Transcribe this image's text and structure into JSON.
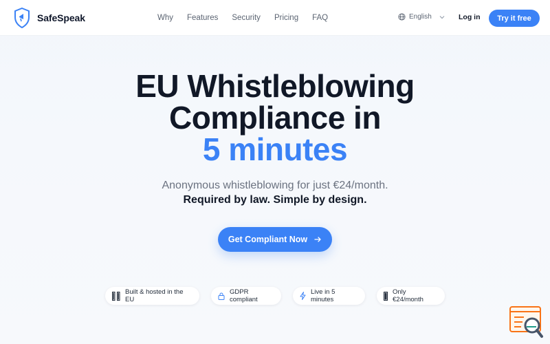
{
  "brand": {
    "name": "SafeSpeak",
    "logo_icon": "shield-icon"
  },
  "nav": {
    "items": [
      "Why",
      "Features",
      "Security",
      "Pricing",
      "FAQ"
    ]
  },
  "header": {
    "language": "English",
    "login_label": "Log in",
    "cta_label": "Try it free"
  },
  "hero": {
    "title_line1": "EU Whistleblowing",
    "title_line2": "Compliance in",
    "title_accent": "5 minutes",
    "subtitle": "Anonymous whistleblowing for just €24/month.",
    "tagline": "Required by law. Simple by design.",
    "cta_label": "Get Compliant Now",
    "cta_icon": "arrow-right-icon"
  },
  "badges": [
    {
      "label": "Built & hosted in the EU",
      "icon": "eu-flag-icon"
    },
    {
      "label": "GDPR compliant",
      "icon": "lock-icon"
    },
    {
      "label": "Live in 5 minutes",
      "icon": "lightning-icon"
    },
    {
      "label": "Only €24/month",
      "icon": "flag-icon"
    }
  ],
  "colors": {
    "accent": "#3b82f6",
    "text_dark": "#111827",
    "text_muted": "#6b7280",
    "corner_widget": "#f97316"
  }
}
